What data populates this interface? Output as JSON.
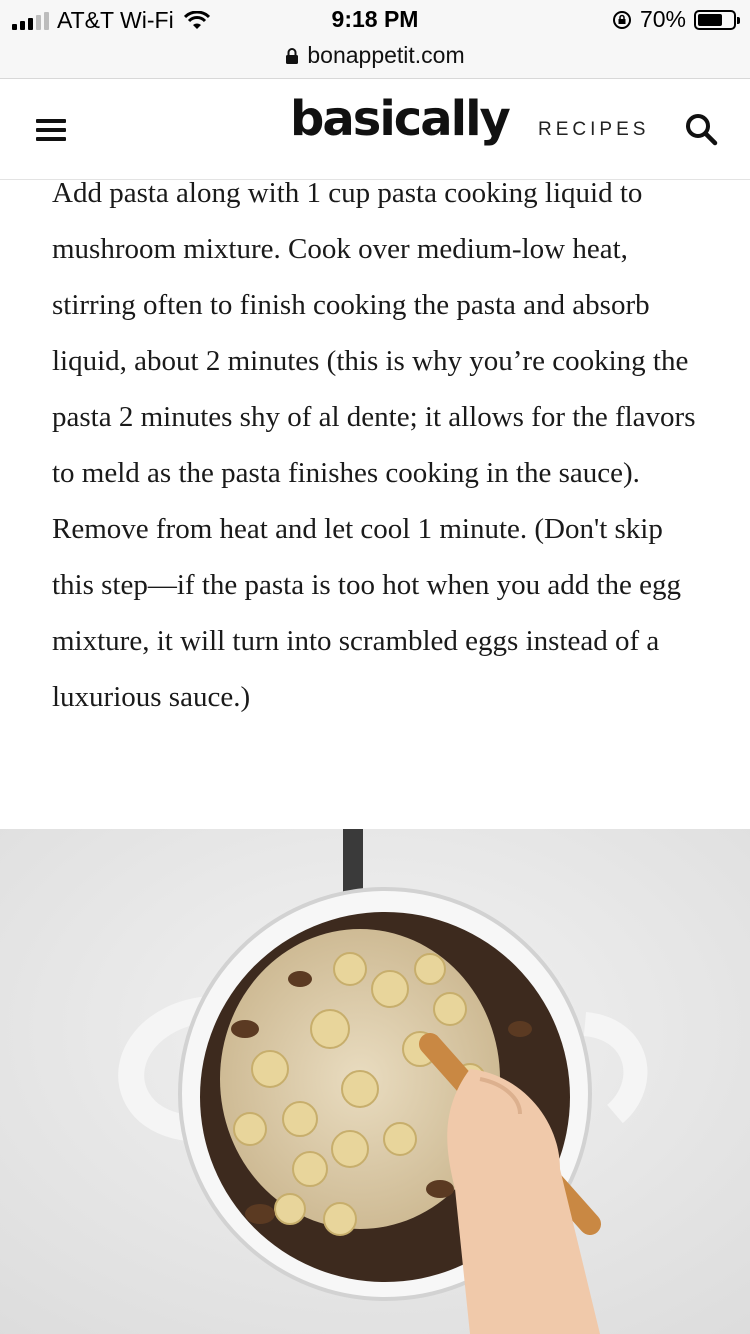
{
  "status_bar": {
    "carrier": "AT&T Wi-Fi",
    "time": "9:18 PM",
    "battery": "70%",
    "battery_level": 0.7
  },
  "browser": {
    "url": "bonappetit.com"
  },
  "header": {
    "logo": "basically",
    "nav_recipes": "RECIPES"
  },
  "article": {
    "paragraph": "Add pasta along with 1 cup pasta cooking liquid to mushroom mixture. Cook over medium-low heat, stirring often to finish cooking the pasta and absorb liquid, about 2 minutes (this is why you’re cooking the pasta 2 minutes shy of al dente; it allows for the flavors to meld as the pasta finishes cooking in the sauce). Remove from heat and let cool 1 minute. (Don't skip this step—if the pasta is too hot when you add the egg mixture, it will turn into scrambled eggs instead of a luxurious sauce.)"
  },
  "icons": {
    "menu": "hamburger-menu-icon",
    "search": "search-icon",
    "secure": "padlock-icon",
    "wifi": "wifi-icon",
    "rotation_lock": "rotation-lock-icon",
    "battery": "battery-icon"
  }
}
